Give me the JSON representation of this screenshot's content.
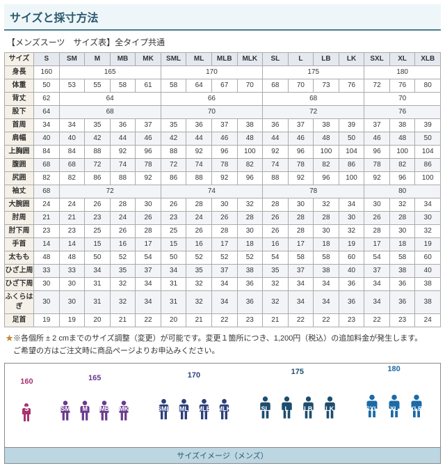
{
  "title": "サイズと採寸方法",
  "subtitle": "【メンズスーツ　サイズ表】全タイプ共通",
  "size_header_label": "サイズ",
  "sizes": [
    "S",
    "SM",
    "M",
    "MB",
    "MK",
    "SML",
    "ML",
    "MLB",
    "MLK",
    "SL",
    "L",
    "LB",
    "LK",
    "SXL",
    "XL",
    "XLB"
  ],
  "height_row": {
    "label": "身長",
    "spans": [
      {
        "text": "160",
        "cols": 1
      },
      {
        "text": "165",
        "cols": 4
      },
      {
        "text": "170",
        "cols": 4
      },
      {
        "text": "175",
        "cols": 4
      },
      {
        "text": "180",
        "cols": 3
      }
    ]
  },
  "rows": [
    {
      "label": "体重",
      "type": "cells",
      "cells": [
        "50",
        "53",
        "55",
        "58",
        "61",
        "58",
        "64",
        "67",
        "70",
        "68",
        "70",
        "73",
        "76",
        "72",
        "76",
        "80"
      ]
    },
    {
      "label": "背丈",
      "type": "spans",
      "spans": [
        {
          "text": "62",
          "cols": 1
        },
        {
          "text": "64",
          "cols": 4
        },
        {
          "text": "66",
          "cols": 4
        },
        {
          "text": "68",
          "cols": 4
        },
        {
          "text": "70",
          "cols": 3
        }
      ]
    },
    {
      "label": "股下",
      "type": "spans",
      "spans": [
        {
          "text": "64",
          "cols": 1
        },
        {
          "text": "68",
          "cols": 4
        },
        {
          "text": "70",
          "cols": 4
        },
        {
          "text": "72",
          "cols": 4
        },
        {
          "text": "76",
          "cols": 3
        }
      ],
      "alt": true
    },
    {
      "label": "首周",
      "type": "cells",
      "cells": [
        "34",
        "34",
        "35",
        "36",
        "37",
        "35",
        "36",
        "37",
        "38",
        "36",
        "37",
        "38",
        "39",
        "37",
        "38",
        "39"
      ]
    },
    {
      "label": "肩幅",
      "type": "cells",
      "cells": [
        "40",
        "40",
        "42",
        "44",
        "46",
        "42",
        "44",
        "46",
        "48",
        "44",
        "46",
        "48",
        "50",
        "46",
        "48",
        "50"
      ],
      "alt": true
    },
    {
      "label": "上胸囲",
      "type": "cells",
      "cells": [
        "84",
        "84",
        "88",
        "92",
        "96",
        "88",
        "92",
        "96",
        "100",
        "92",
        "96",
        "100",
        "104",
        "96",
        "100",
        "104"
      ]
    },
    {
      "label": "腹囲",
      "type": "cells",
      "cells": [
        "68",
        "68",
        "72",
        "74",
        "78",
        "72",
        "74",
        "78",
        "82",
        "74",
        "78",
        "82",
        "86",
        "78",
        "82",
        "86"
      ],
      "alt": true
    },
    {
      "label": "尻囲",
      "type": "cells",
      "cells": [
        "82",
        "82",
        "86",
        "88",
        "92",
        "86",
        "88",
        "92",
        "96",
        "88",
        "92",
        "96",
        "100",
        "92",
        "96",
        "100"
      ]
    },
    {
      "label": "袖丈",
      "type": "spans",
      "spans": [
        {
          "text": "68",
          "cols": 1
        },
        {
          "text": "72",
          "cols": 4
        },
        {
          "text": "74",
          "cols": 4
        },
        {
          "text": "78",
          "cols": 4
        },
        {
          "text": "80",
          "cols": 3
        }
      ],
      "alt": true
    },
    {
      "label": "大腕囲",
      "type": "cells",
      "cells": [
        "24",
        "24",
        "26",
        "28",
        "30",
        "26",
        "28",
        "30",
        "32",
        "28",
        "30",
        "32",
        "34",
        "30",
        "32",
        "34"
      ]
    },
    {
      "label": "肘周",
      "type": "cells",
      "cells": [
        "21",
        "21",
        "23",
        "24",
        "26",
        "23",
        "24",
        "26",
        "28",
        "26",
        "28",
        "28",
        "30",
        "26",
        "28",
        "30"
      ],
      "alt": true
    },
    {
      "label": "肘下周",
      "type": "cells",
      "cells": [
        "23",
        "23",
        "25",
        "26",
        "28",
        "25",
        "26",
        "28",
        "30",
        "26",
        "28",
        "30",
        "32",
        "28",
        "30",
        "32"
      ]
    },
    {
      "label": "手首",
      "type": "cells",
      "cells": [
        "14",
        "14",
        "15",
        "16",
        "17",
        "15",
        "16",
        "17",
        "18",
        "16",
        "17",
        "18",
        "19",
        "17",
        "18",
        "19"
      ],
      "alt": true
    },
    {
      "label": "太もも",
      "type": "cells",
      "cells": [
        "48",
        "48",
        "50",
        "52",
        "54",
        "50",
        "52",
        "52",
        "52",
        "54",
        "58",
        "58",
        "60",
        "54",
        "58",
        "60"
      ]
    },
    {
      "label": "ひざ上周",
      "type": "cells",
      "cells": [
        "33",
        "33",
        "34",
        "35",
        "37",
        "34",
        "35",
        "37",
        "38",
        "35",
        "37",
        "38",
        "40",
        "37",
        "38",
        "40"
      ],
      "alt": true
    },
    {
      "label": "ひざ下周",
      "type": "cells",
      "cells": [
        "30",
        "30",
        "31",
        "32",
        "34",
        "31",
        "32",
        "34",
        "36",
        "32",
        "34",
        "34",
        "36",
        "34",
        "36",
        "38"
      ]
    },
    {
      "label": "ふくらはぎ",
      "type": "cells",
      "cells": [
        "30",
        "30",
        "31",
        "32",
        "34",
        "31",
        "32",
        "34",
        "36",
        "32",
        "34",
        "34",
        "36",
        "34",
        "36",
        "38"
      ],
      "alt": true
    },
    {
      "label": "足首",
      "type": "cells",
      "cells": [
        "19",
        "19",
        "20",
        "21",
        "22",
        "20",
        "21",
        "22",
        "23",
        "21",
        "22",
        "22",
        "23",
        "22",
        "23",
        "24"
      ]
    }
  ],
  "notes": [
    "※各個所 ± 2 cmまでのサイズ調整（変更）が可能です。変更１箇所につき、1,200円（税込）の追加料金が発生します。",
    "　ご希望の方はご注文時に商品ページよりお申込みください。"
  ],
  "silhouette_groups": [
    {
      "height": "160",
      "cls": "g160",
      "scale": 0.8,
      "items": [
        "S"
      ]
    },
    {
      "height": "165",
      "cls": "g165",
      "scale": 0.85,
      "items": [
        "SM",
        "M",
        "MB",
        "MK"
      ]
    },
    {
      "height": "170",
      "cls": "g170",
      "scale": 0.9,
      "items": [
        "SML",
        "ML",
        "MLB",
        "MLK"
      ]
    },
    {
      "height": "175",
      "cls": "g175",
      "scale": 0.95,
      "items": [
        "SL",
        "L",
        "LB",
        "LK"
      ]
    },
    {
      "height": "180",
      "cls": "g180",
      "scale": 1.0,
      "items": [
        "SXL",
        "XL",
        "XLB"
      ]
    }
  ],
  "img_footer": "サイズイメージ（メンズ）"
}
